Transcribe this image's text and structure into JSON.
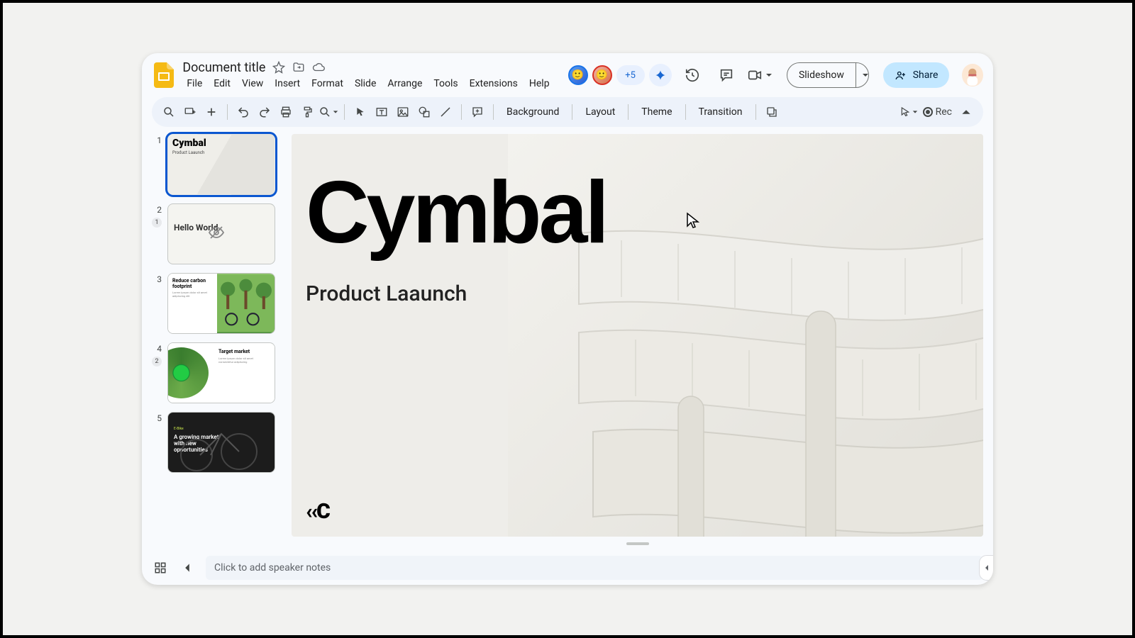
{
  "header": {
    "doc_title": "Document title",
    "menus": [
      "File",
      "Edit",
      "View",
      "Insert",
      "Format",
      "Slide",
      "Arrange",
      "Tools",
      "Extensions",
      "Help"
    ],
    "collab_count": "+5",
    "slideshow_label": "Slideshow",
    "share_label": "Share"
  },
  "toolbar": {
    "background": "Background",
    "layout": "Layout",
    "theme": "Theme",
    "transition": "Transition",
    "rec": "Rec"
  },
  "filmstrip": {
    "slides": [
      {
        "num": "1",
        "title": "Cymbal",
        "sub": "Product Laaunch",
        "badge": ""
      },
      {
        "num": "2",
        "title": "Hello World.",
        "sub": "",
        "badge": "1"
      },
      {
        "num": "3",
        "title": "Reduce carbon footprint",
        "sub": "",
        "badge": ""
      },
      {
        "num": "4",
        "title": "Target market",
        "sub": "",
        "badge": "2"
      },
      {
        "num": "5",
        "title": "A growing market with new opportunities",
        "sub": "",
        "badge": ""
      }
    ]
  },
  "canvas": {
    "title": "Cymbal",
    "subtitle": "Product Laaunch",
    "mark": "‹‹C"
  },
  "notes": {
    "placeholder": "Click to add speaker notes"
  }
}
